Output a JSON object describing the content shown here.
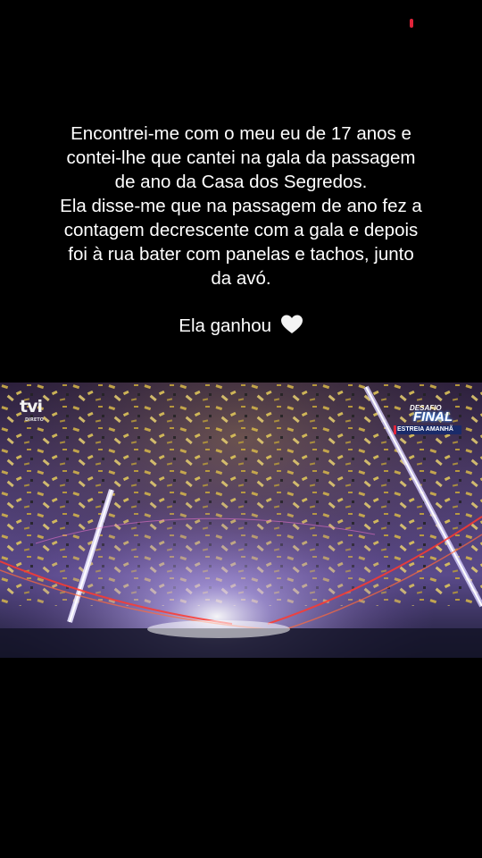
{
  "caption": {
    "lines": [
      "Encontrei-me com o meu eu de 17 anos e",
      "contei-lhe que cantei na gala da passagem",
      "de ano da Casa dos Segredos.",
      "Ela disse-me que na passagem de ano fez a",
      "contagem decrescente com a gala e depois",
      "foi à rua bater com panelas e tachos, junto",
      "da avó."
    ],
    "signoff": "Ela ganhou",
    "signoff_icon": "white-heart-icon"
  },
  "video": {
    "channel_logo": "tvi",
    "channel_badge": "DIRETO",
    "promo_top": "DESAFIO",
    "promo_main": "FINAL",
    "promo_strap": "ESTREIA AMANHÃ"
  },
  "colors": {
    "background": "#000000",
    "text": "#ffffff",
    "status_dot": "#e0243a",
    "confetti": "#d8b84a",
    "stage_light": "#e8e4ff",
    "stage_laser": "#ff3a2e"
  }
}
